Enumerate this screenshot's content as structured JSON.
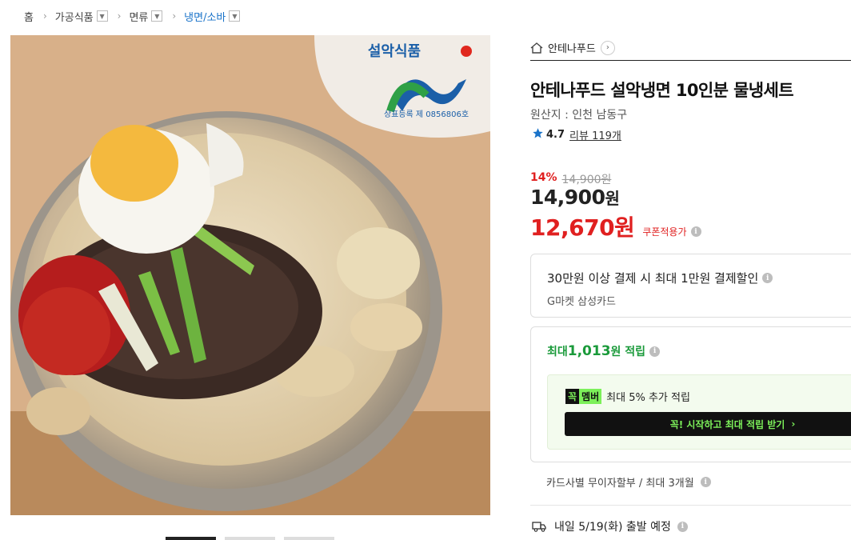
{
  "breadcrumb": {
    "home": "홈",
    "level1": "가공식품",
    "level2": "면류",
    "level3": "냉면/소바"
  },
  "image": {
    "brand_text": "설악식품",
    "registration_text": "상표등록 제 0856806호"
  },
  "seller": {
    "name": "안테나푸드"
  },
  "product": {
    "title": "안테나푸드 설악냉면 10인분 물냉세트",
    "origin": "원산지 : 인천 남동구",
    "rating": "4.7",
    "reviews": "리뷰 119개"
  },
  "price": {
    "discount_pct": "14%",
    "original": "14,900원",
    "main_value": "14,900",
    "main_unit": "원",
    "sale": "12,670원",
    "coupon_label": "쿠폰적용가"
  },
  "card_offer": {
    "title": "30만원 이상 결제 시 최대 1만원 결제할인",
    "card": "G마켓 삼성카드"
  },
  "reward": {
    "prefix": "최대 ",
    "amount": "1,013",
    "suffix": "원 적립",
    "member_badge_1": "꼭",
    "member_badge_2": "멤버",
    "member_text": "최대 5% 추가 적립",
    "member_button": "꼭! 시작하고 최대 적립 받기",
    "member_button_arrow": "›"
  },
  "installment": "카드사별 무이자할부 / 최대 3개월",
  "shipping": "내일 5/19(화) 출발 예정",
  "colors": {
    "accent_red": "#e02020",
    "reward_green": "#1a9a3a",
    "member_green": "#7cf05a",
    "link_blue": "#1a73c9"
  },
  "icons": [
    "chevron-down-icon",
    "home-icon",
    "chevron-right-icon",
    "star-icon",
    "info-icon",
    "truck-icon"
  ]
}
